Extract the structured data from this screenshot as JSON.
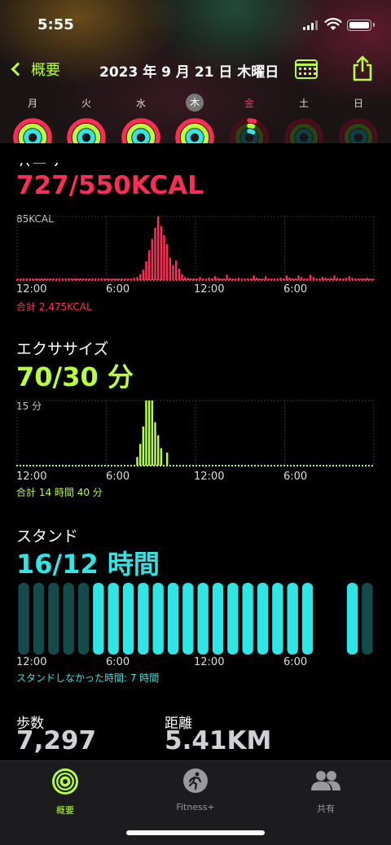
{
  "status_bar": {
    "time": "5:55"
  },
  "nav": {
    "back_label": "概要",
    "title": "2023 年 9 月 21 日 木曜日"
  },
  "week": {
    "days": [
      {
        "label": "月",
        "move": 1.0,
        "exercise": 1.0,
        "stand": 1.0
      },
      {
        "label": "火",
        "move": 1.0,
        "exercise": 1.0,
        "stand": 1.0
      },
      {
        "label": "水",
        "move": 1.0,
        "exercise": 1.0,
        "stand": 1.0
      },
      {
        "label": "木",
        "move": 1.0,
        "exercise": 1.0,
        "stand": 1.0,
        "today": true
      },
      {
        "label": "金",
        "move": 0.05,
        "exercise": 0.05,
        "stand": 0.1
      },
      {
        "label": "土",
        "move": 0,
        "exercise": 0,
        "stand": 0
      },
      {
        "label": "日",
        "move": 0,
        "exercise": 0,
        "stand": 0
      }
    ]
  },
  "move": {
    "title_partial": "ムーブ",
    "value": "727/550KCAL",
    "max_label": "85KCAL",
    "ticks": [
      "12:00",
      "6:00",
      "12:00",
      "6:00"
    ],
    "total": "合計 2,475KCAL",
    "color": "#ff2d55"
  },
  "exercise": {
    "title": "エクササイズ",
    "value": "70/30 分",
    "max_label": "15 分",
    "ticks": [
      "12:00",
      "6:00",
      "12:00",
      "6:00"
    ],
    "total": "合計 14 時間 40 分",
    "color": "#b6ff3a"
  },
  "stand": {
    "title": "スタンド",
    "value": "16/12 時間",
    "ticks": [
      "12:00",
      "6:00",
      "12:00",
      "6:00"
    ],
    "total": "スタンドしなかった時間: 7 時間",
    "color": "#2fe6e6"
  },
  "stats": {
    "steps_label": "歩数",
    "steps_value": "7,297",
    "distance_label": "距離",
    "distance_value": "5.41KM"
  },
  "tabs": [
    {
      "label": "概要",
      "icon": "activity-rings-icon",
      "active": true
    },
    {
      "label": "Fitness+",
      "icon": "runner-icon",
      "active": false
    },
    {
      "label": "共有",
      "icon": "people-icon",
      "active": false
    }
  ],
  "chart_data": [
    {
      "type": "bar",
      "title": "ムーブ",
      "ylabel": "85KCAL",
      "ylim": [
        0,
        85
      ],
      "x_ticks": [
        "12:00",
        "6:00",
        "12:00",
        "6:00"
      ],
      "values": [
        2,
        2,
        2,
        2,
        2,
        2,
        2,
        2,
        2,
        2,
        2,
        2,
        2,
        2,
        2,
        2,
        2,
        2,
        2,
        2,
        2,
        2,
        2,
        2,
        2,
        2,
        2,
        2,
        2,
        2,
        2,
        2,
        2,
        2,
        2,
        2,
        2,
        2,
        2,
        3,
        4,
        8,
        14,
        25,
        40,
        55,
        70,
        85,
        72,
        60,
        48,
        30,
        20,
        26,
        15,
        8,
        4,
        3,
        2,
        2,
        2,
        4,
        2,
        2,
        3,
        2,
        5,
        3,
        2,
        2,
        7,
        3,
        2,
        2,
        3,
        2,
        2,
        2,
        2,
        6,
        3,
        2,
        2,
        5,
        2,
        2,
        2,
        2,
        3,
        2,
        6,
        3,
        2,
        2,
        6,
        4,
        2,
        2,
        7,
        4,
        2,
        2,
        4,
        3,
        2,
        3,
        6,
        3,
        2,
        2,
        3,
        5,
        3,
        2,
        2,
        2,
        2,
        3,
        2,
        2
      ],
      "total": "合計 2,475KCAL"
    },
    {
      "type": "bar",
      "title": "エクササイズ",
      "ylabel": "15 分",
      "ylim": [
        0,
        15
      ],
      "x_ticks": [
        "12:00",
        "6:00",
        "12:00",
        "6:00"
      ],
      "values": [
        0,
        0,
        0,
        0,
        0,
        0,
        0,
        0,
        0,
        0,
        0,
        0,
        0,
        0,
        0,
        0,
        0,
        0,
        0,
        0,
        0,
        0,
        0,
        0,
        0,
        0,
        0,
        0,
        0,
        0,
        0,
        0,
        0,
        0,
        0,
        0,
        0,
        0,
        0,
        0,
        2,
        5,
        9,
        15,
        15,
        15,
        10,
        7,
        4,
        0,
        3,
        0,
        0,
        0,
        0,
        0,
        0,
        0,
        0,
        0,
        0,
        0,
        0,
        0,
        0,
        0,
        0,
        0,
        0,
        0,
        0,
        0,
        0,
        0,
        0,
        0,
        0,
        0,
        0,
        0,
        0,
        0,
        0,
        0,
        0,
        0,
        0,
        0,
        0,
        0,
        0,
        0,
        0,
        0,
        0,
        0,
        0,
        0,
        0,
        0,
        0,
        0,
        0,
        0,
        0,
        0,
        0,
        0,
        0,
        0,
        0,
        0,
        0,
        0,
        0,
        0,
        0,
        0,
        0,
        0
      ],
      "total": "合計 14 時間 40 分"
    },
    {
      "type": "bar",
      "title": "スタンド",
      "x_ticks": [
        "12:00",
        "6:00",
        "12:00",
        "6:00"
      ],
      "values": [
        0,
        0,
        0,
        0,
        0,
        1,
        1,
        1,
        1,
        1,
        1,
        1,
        1,
        1,
        1,
        1,
        1,
        1,
        1,
        1,
        0,
        0,
        1,
        0,
        0
      ],
      "notes": "1 = stood that hour, 0 = did not",
      "total": "スタンドしなかった時間: 7 時間"
    }
  ]
}
